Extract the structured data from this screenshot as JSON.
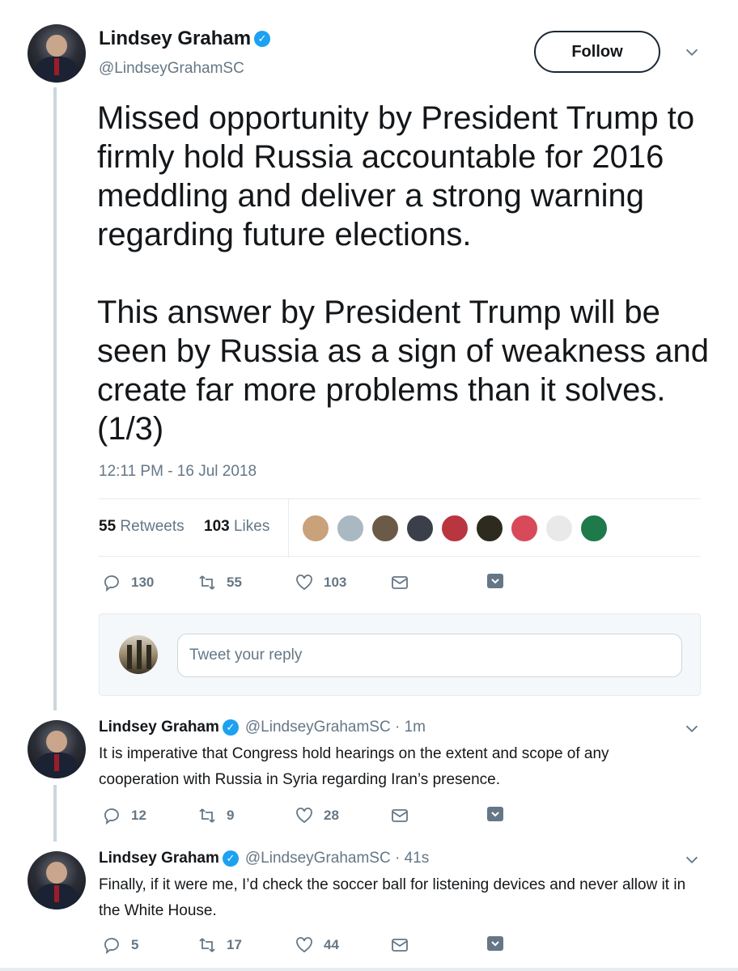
{
  "main_tweet": {
    "author_name": "Lindsey Graham",
    "handle": "@LindseyGrahamSC",
    "follow_label": "Follow",
    "text": "Missed opportunity by President Trump to firmly hold Russia accountable for 2016 meddling and deliver a strong warning regarding future elections.\n\nThis answer by President Trump will be seen by Russia as a sign of weakness and create far more problems than it solves. (1/3)",
    "timestamp": "12:11 PM - 16 Jul 2018",
    "retweets_count": "55",
    "retweets_label": "Retweets",
    "likes_count": "103",
    "likes_label": "Likes",
    "liker_colors": [
      "#c9a17a",
      "#aab8c2",
      "#6b5a48",
      "#3a3f4a",
      "#b9353f",
      "#2d2a1e",
      "#d84a5a",
      "#e9e9e9",
      "#1e7a4b"
    ],
    "actions": {
      "replies": "130",
      "retweets": "55",
      "likes": "103"
    }
  },
  "reply_box": {
    "placeholder": "Tweet your reply"
  },
  "replies": [
    {
      "author_name": "Lindsey Graham",
      "handle": "@LindseyGrahamSC · 1m",
      "text": "It is imperative that Congress hold hearings on the extent and scope of any cooperation with Russia in Syria regarding Iran’s presence.",
      "replies": "12",
      "retweets": "9",
      "likes": "28"
    },
    {
      "author_name": "Lindsey Graham",
      "handle": "@LindseyGrahamSC · 41s",
      "text": "Finally, if it were me, I’d check the soccer ball for listening devices and never allow it in the White House.",
      "replies": "5",
      "retweets": "17",
      "likes": "44"
    }
  ],
  "colors": {
    "verified": "#1da1f2",
    "muted": "#657786",
    "border": "#e6ecf0"
  }
}
